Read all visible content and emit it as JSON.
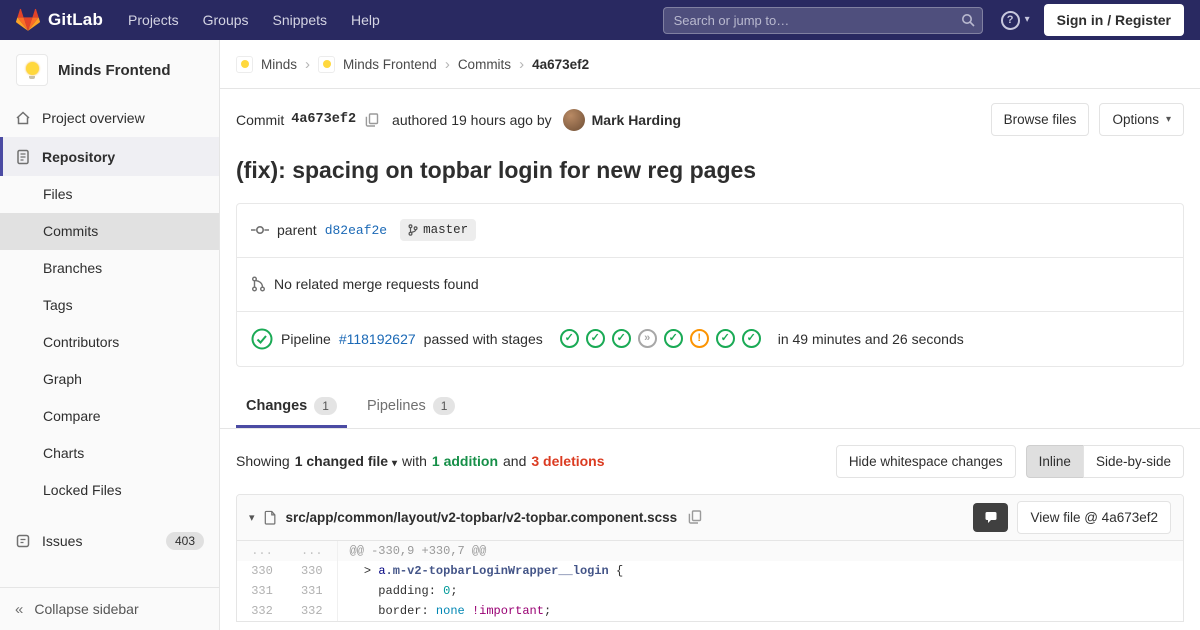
{
  "colors": {
    "navbar_bg": "#292961",
    "accent": "#4b4ba3",
    "link": "#1b69b6",
    "success": "#1aaa55",
    "warning": "#fc9403",
    "danger": "#db3b21"
  },
  "icons": {
    "caret_down": "▾",
    "chevron_right": "›",
    "collapse": "«",
    "question": "?"
  },
  "navbar": {
    "brand": "GitLab",
    "menu": [
      "Projects",
      "Groups",
      "Snippets",
      "Help"
    ],
    "search_placeholder": "Search or jump to…",
    "sign_in_label": "Sign in / Register"
  },
  "sidebar": {
    "project_name": "Minds Frontend",
    "overview_label": "Project overview",
    "repository_label": "Repository",
    "repo_items": [
      "Files",
      "Commits",
      "Branches",
      "Tags",
      "Contributors",
      "Graph",
      "Compare",
      "Charts",
      "Locked Files"
    ],
    "issues_label": "Issues",
    "issues_count": "403",
    "collapse_label": "Collapse sidebar"
  },
  "breadcrumb": {
    "minds": "Minds",
    "minds_frontend": "Minds Frontend",
    "commits": "Commits",
    "sha": "4a673ef2"
  },
  "commit": {
    "label": "Commit",
    "sha": "4a673ef2",
    "authored_text": "authored 19 hours ago by",
    "author": "Mark Harding",
    "browse_files_label": "Browse files",
    "options_label": "Options",
    "title": "(fix): spacing on topbar login for new reg pages"
  },
  "info": {
    "parent_label": "parent",
    "parent_sha": "d82eaf2e",
    "branch": "master",
    "no_mr_text": "No related merge requests found",
    "pipeline_label": "Pipeline",
    "pipeline_id": "#118192627",
    "pipeline_status_text": "passed with stages",
    "pipeline_duration": "in 49 minutes and 26 seconds",
    "stages": [
      {
        "status": "success",
        "glyph": "✓"
      },
      {
        "status": "success",
        "glyph": "✓"
      },
      {
        "status": "success",
        "glyph": "✓"
      },
      {
        "status": "skipped",
        "glyph": "»"
      },
      {
        "status": "success",
        "glyph": "✓"
      },
      {
        "status": "warning",
        "glyph": "!"
      },
      {
        "status": "success",
        "glyph": "✓"
      },
      {
        "status": "success",
        "glyph": "✓"
      }
    ]
  },
  "tabs": {
    "changes_label": "Changes",
    "changes_count": "1",
    "pipelines_label": "Pipelines",
    "pipelines_count": "1"
  },
  "summary": {
    "showing_label": "Showing",
    "changed_files_label": "1 changed file",
    "with_label": "with",
    "additions_label": "1 addition",
    "and_label": "and",
    "deletions_label": "3 deletions",
    "hide_whitespace_label": "Hide whitespace changes",
    "inline_label": "Inline",
    "side_by_side_label": "Side-by-side"
  },
  "diff": {
    "file_path": "src/app/common/layout/v2-topbar/v2-topbar.component.scss",
    "view_file_label": "View file @ 4a673ef2",
    "hunk_old": "...",
    "hunk_new": "...",
    "hunk_header": "@@ -330,9 +330,7 @@",
    "lines": [
      {
        "old": "330",
        "new": "330",
        "t0": "  > ",
        "t1": "a",
        "t2": ".m-v2-topbarLoginWrapper__login",
        "t3": " {"
      },
      {
        "old": "331",
        "new": "331",
        "t0": "    padding: ",
        "t1": "0",
        "t2": ";"
      },
      {
        "old": "332",
        "new": "332",
        "t0": "    border: ",
        "t1": "none",
        "t2": " ",
        "t3": "!important",
        "t4": ";"
      }
    ]
  }
}
